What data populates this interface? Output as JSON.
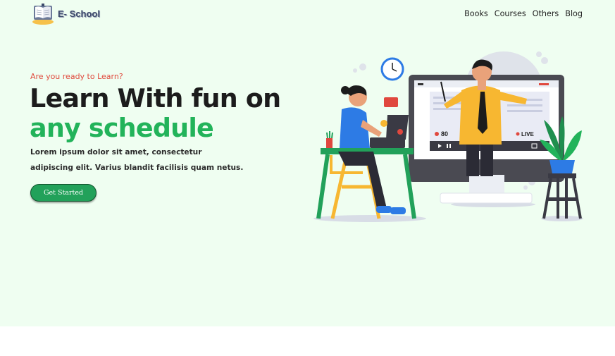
{
  "header": {
    "logo_text": "E- School",
    "nav": [
      "Books",
      "Courses",
      "Others",
      "Blog"
    ]
  },
  "hero": {
    "eyebrow": "Are you ready to Learn?",
    "title_line1": "Learn With fun on",
    "title_line2": "any schedule",
    "desc_line1": "Lorem ipsum dolor sit amet, consectetur",
    "desc_line2": "adipiscing elit. Varius blandit facilisis quam netus.",
    "cta_label": "Get Started",
    "illustration": {
      "viewer_count": "80",
      "live_label": "LIVE"
    }
  },
  "colors": {
    "hero_bg": "#effef1",
    "accent_green": "#22b35a",
    "eyebrow_red": "#e04a3d",
    "button_green": "#22a15a"
  }
}
